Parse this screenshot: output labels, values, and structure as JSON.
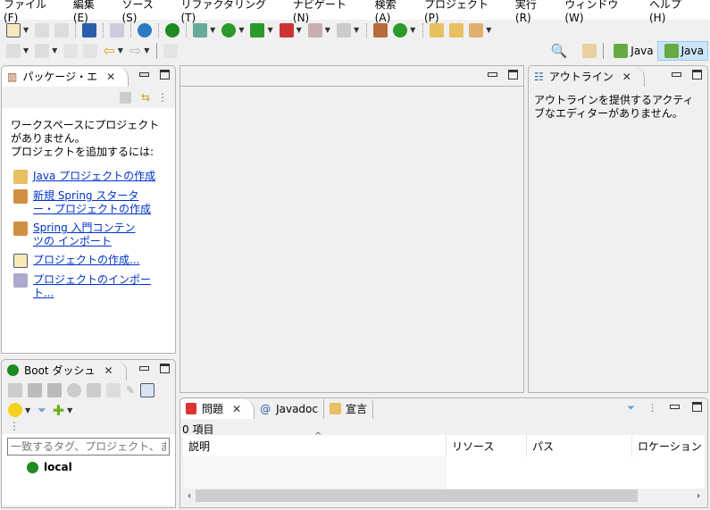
{
  "menu": [
    "ファイル(F)",
    "編集(E)",
    "ソース(S)",
    "リファクタリング(T)",
    "ナビゲート(N)",
    "検索(A)",
    "プロジェクト(P)",
    "実行(R)",
    "ウィンドウ(W)",
    "ヘルプ(H)"
  ],
  "perspectives": [
    "Java",
    "Java"
  ],
  "package_explorer": {
    "tab": "パッケージ・エ",
    "message": "ワークスペースにプロジェクトがありません。",
    "prompt": "プロジェクトを追加するには:",
    "links": [
      "Java プロジェクトの作成",
      "新規 Spring スターター・プロジェクトの作成",
      "Spring 入門コンテンツの インポート",
      "プロジェクトの作成...",
      "プロジェクトのインポート..."
    ]
  },
  "outline": {
    "tab": "アウトライン",
    "message": "アウトラインを提供するアクティブなエディターがありません。"
  },
  "boot_dash": {
    "tab": "Boot ダッシュ",
    "filter_placeholder": "一致するタグ、プロジェクト、またはワークスペース",
    "items": [
      "local"
    ]
  },
  "bottom": {
    "tabs": [
      "問題",
      "Javadoc",
      "宣言"
    ],
    "count": "0 項目",
    "columns": [
      "説明",
      "リソース",
      "パス",
      "ロケーション"
    ]
  },
  "colors": {
    "accent": "#cce4f7",
    "link": "#0033cc",
    "spring": "#1f8a1f"
  }
}
